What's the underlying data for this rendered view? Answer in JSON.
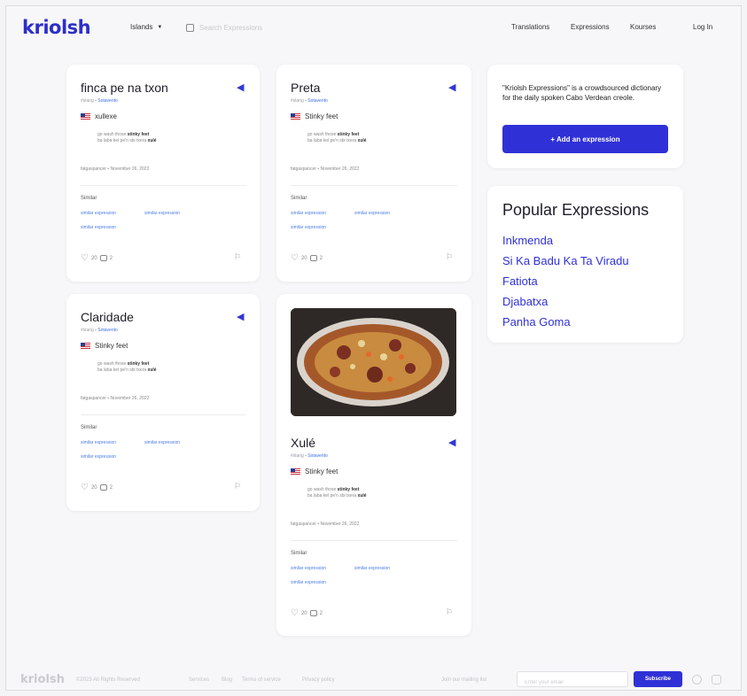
{
  "header": {
    "logo": "kriolsh",
    "islands": "Islands",
    "search_placeholder": "Search Expressions",
    "nav": [
      "Translations",
      "Expressions",
      "Kourses"
    ],
    "login": "Log In"
  },
  "cards": [
    {
      "title": "finca pe na txon",
      "tag": "#slang",
      "island": "Sotavento",
      "translation": "xullexe",
      "example_line1": "go wash those ",
      "example_bold1": "stinky feet",
      "example_line2": "ba laba kel pe'n sbi txera ",
      "example_bold2": "xulé",
      "author": "fatgaspancer",
      "date": "November 26, 2022",
      "similar": "Similar",
      "similar_links": [
        "similar expression",
        "similar expression",
        "similar expression"
      ],
      "likes": "20",
      "comments": "2"
    },
    {
      "title": "Preta",
      "tag": "#slang",
      "island": "Sotavento",
      "translation": "Stinky feet",
      "example_line1": "go wash those ",
      "example_bold1": "stinky feet",
      "example_line2": "ba laba kel pe'n sbi txera ",
      "example_bold2": "xulé",
      "author": "fatgaspancer",
      "date": "November 26, 2022",
      "similar": "Similar",
      "similar_links": [
        "similar expression",
        "similar expression",
        "similar expression"
      ],
      "likes": "20",
      "comments": "2"
    },
    {
      "title": "Claridade",
      "tag": "#slang",
      "island": "Sotavento",
      "translation": "Stinky feet",
      "example_line1": "go wash those ",
      "example_bold1": "stinky feet",
      "example_line2": "ba laba kel pe'n sbi txera ",
      "example_bold2": "xulé",
      "author": "fatgaspancer",
      "date": "November 26, 2022",
      "similar": "Similar",
      "similar_links": [
        "similar expression",
        "similar expression",
        "similar expression"
      ],
      "likes": "20",
      "comments": "2"
    },
    {
      "title": "Xulé",
      "tag": "#slang",
      "island": "Sotavento",
      "translation": "Stinky feet",
      "example_line1": "go wash those ",
      "example_bold1": "stinky feet",
      "example_line2": "ba laba kel pe'n sbi txera ",
      "example_bold2": "xulé",
      "author": "fatgaspancer",
      "date": "November 26, 2022",
      "similar": "Similar",
      "similar_links": [
        "similar expression",
        "similar expression",
        "similar expression"
      ],
      "likes": "20",
      "comments": "2"
    }
  ],
  "sidebar": {
    "about": "\"Kriolsh Expressions\" is a crowdsourced dictionary for the daily spoken Cabo Verdean creole.",
    "add_button": "+ Add an expression",
    "popular_title": "Popular Expressions",
    "popular": [
      "Inkmenda",
      "Si Ka Badu Ka Ta Viradu",
      "Fatiota",
      "Djabatxa",
      "Panha Goma"
    ]
  },
  "footer": {
    "logo": "kriolsh",
    "copyright": "©2023 All Rights Reserved",
    "links": [
      "Services",
      "Blog",
      "Terms of service",
      "Privacy policy"
    ],
    "newsletter": "Join our mailing list",
    "email_placeholder": "Enter your email",
    "subscribe": "Subscribe"
  },
  "colors": {
    "brand": "#2c2fc9",
    "link": "#4a7be6"
  },
  "icons": [
    "chevron-down-icon",
    "search-icon",
    "speaker-icon",
    "us-flag-icon",
    "heart-icon",
    "comment-icon",
    "report-flag-icon",
    "github-icon",
    "instagram-icon"
  ]
}
